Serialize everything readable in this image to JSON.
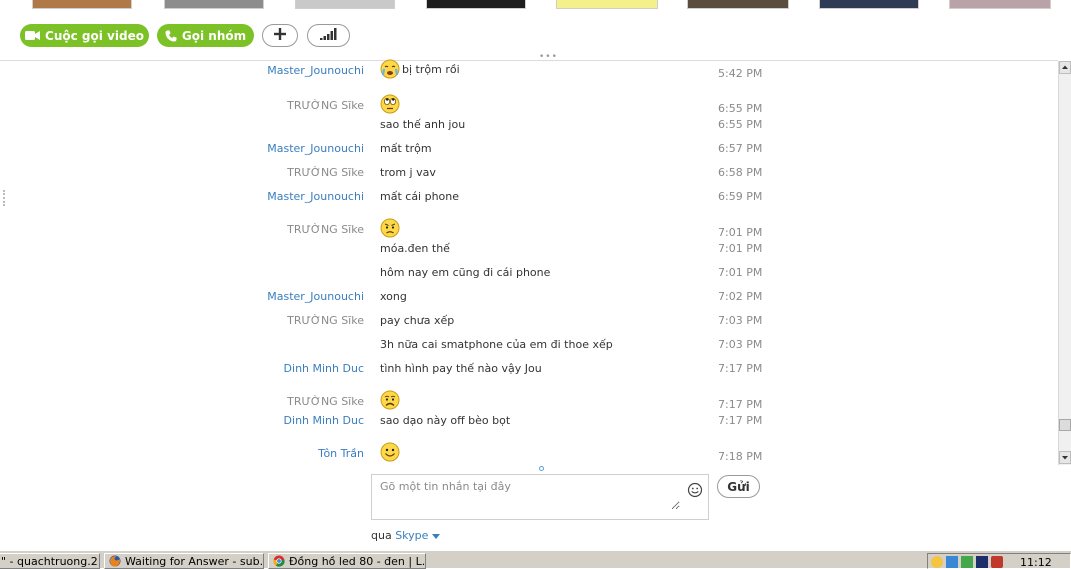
{
  "toolbar": {
    "video_call_label": "Cuộc gọi video",
    "group_call_label": "Gọi nhóm",
    "add_label": "+"
  },
  "messages": [
    {
      "sender": "Master_Jounouchi",
      "sender_color": "blue",
      "text": "bị trộm rồi",
      "emoji": "crying",
      "time": "5:42 PM"
    },
    {
      "sender": "TRƯỜNG Sĩke",
      "sender_color": "gray",
      "text": "",
      "emoji": "eye-roll",
      "time": "6:55 PM"
    },
    {
      "sender": "",
      "sender_color": "gray",
      "text": "sao thế anh jou",
      "emoji": "",
      "time": "6:55 PM"
    },
    {
      "sender": "Master_Jounouchi",
      "sender_color": "blue",
      "text": "mất trộm",
      "emoji": "",
      "time": "6:57 PM"
    },
    {
      "sender": "TRƯỜNG Sĩke",
      "sender_color": "gray",
      "text": "trom j vav",
      "emoji": "",
      "time": "6:58 PM"
    },
    {
      "sender": "Master_Jounouchi",
      "sender_color": "blue",
      "text": "mất cái phone",
      "emoji": "",
      "time": "6:59 PM"
    },
    {
      "sender": "TRƯỜNG Sĩke",
      "sender_color": "gray",
      "text": "",
      "emoji": "worried",
      "time": "7:01 PM"
    },
    {
      "sender": "",
      "sender_color": "gray",
      "text": "móa.đen thế",
      "emoji": "",
      "time": "7:01 PM"
    },
    {
      "sender": "",
      "sender_color": "gray",
      "text": "hôm nay em cũng đi cái phone",
      "emoji": "",
      "time": "7:01 PM"
    },
    {
      "sender": "Master_Jounouchi",
      "sender_color": "blue",
      "text": "xong",
      "emoji": "",
      "time": "7:02 PM"
    },
    {
      "sender": "TRƯỜNG Sĩke",
      "sender_color": "gray",
      "text": "pay chưa xếp",
      "emoji": "",
      "time": "7:03 PM"
    },
    {
      "sender": "",
      "sender_color": "gray",
      "text": "3h nữa cai smatphone của em đi thoe xếp",
      "emoji": "",
      "time": "7:03 PM"
    },
    {
      "sender": "Dinh Minh Duc",
      "sender_color": "blue",
      "text": "tình hình pay thế nào vậy Jou",
      "emoji": "",
      "time": "7:17 PM"
    },
    {
      "sender": "TRƯỜNG Sĩke",
      "sender_color": "gray",
      "text": "",
      "emoji": "sad",
      "time": "7:17 PM"
    },
    {
      "sender": "Dinh Minh Duc",
      "sender_color": "blue",
      "text": "sao dạo này off bèo bọt",
      "emoji": "",
      "time": "7:17 PM"
    },
    {
      "sender": "Tôn Trần",
      "sender_color": "blue",
      "text": "",
      "emoji": "smile",
      "time": "7:18 PM"
    }
  ],
  "compose": {
    "placeholder": "Gõ một tin nhắn tại đây",
    "send_label": "Gửi",
    "via_label": "qua",
    "via_link": "Skype"
  },
  "taskbar": {
    "items": [
      {
        "label": "\" - quachtruong.2...",
        "icon": "skype-icon"
      },
      {
        "label": "Waiting for Answer - sub...",
        "icon": "firefox-icon"
      },
      {
        "label": "Đồng hồ led 80 - đen | L...",
        "icon": "chrome-icon"
      }
    ],
    "clock": "11:12"
  },
  "colors": {
    "accent_green": "#7cc126",
    "link_blue": "#3a7ebf",
    "muted_gray": "#8a8a8a"
  }
}
